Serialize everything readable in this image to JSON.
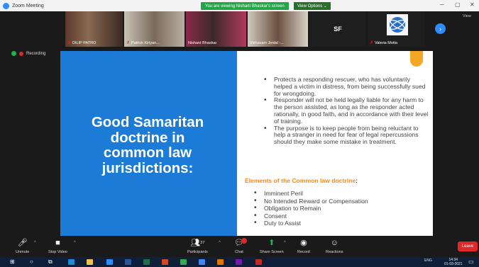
{
  "titlebar": {
    "app_title": "Zoom Meeting",
    "share_banner": "You are viewing Nishant Bhaskar's screen",
    "view_options": "View Options ⌄"
  },
  "participants": [
    {
      "name": "DILIP PATRO",
      "muted": true
    },
    {
      "name": "Patrick Kiriyan...",
      "muted": true
    },
    {
      "name": "Nishant Bhaskar",
      "muted": false
    },
    {
      "name": "Vishavam Jindal -...",
      "muted": false
    },
    {
      "name": "SF",
      "muted": false
    },
    {
      "name": "Valeria Motta",
      "muted": true
    }
  ],
  "sf_initials": "SF",
  "view_corner": "View",
  "recording_label": "Recording",
  "slide": {
    "title": "Good Samaritan\ndoctrine in\ncommon law\njurisdictions:",
    "bullets": [
      "Protects a responding rescuer, who has voluntarily helped a victim in distress, from being successfully sued for wrongdoing.",
      "Responder will not be held legally liable for any harm to the person assisted, as long as the responder acted rationally, in good faith, and in accordance with their level of training.",
      "The purpose is to keep people from being reluctant to help a stranger in need for fear of legal repercussions should they make some mistake in treatment."
    ],
    "elements_heading": "Elements of the Common law doctrine",
    "elements_colon": ":",
    "elements": [
      "Imminent Peril",
      "No Intended Reward or Compensation",
      "Obligation to Remain",
      "Consent",
      "Duty to Assist"
    ]
  },
  "toolbar": {
    "unmute": "Unmute",
    "stop_video": "Stop Video",
    "participants": "Participants",
    "participants_count": "27",
    "chat": "Chat",
    "share_screen": "Share Screen",
    "record": "Record",
    "reactions": "Reactions",
    "leave": "Leave"
  },
  "taskbar": {
    "lang": "ENG",
    "time": "14:34",
    "date": "01-03-2021"
  }
}
